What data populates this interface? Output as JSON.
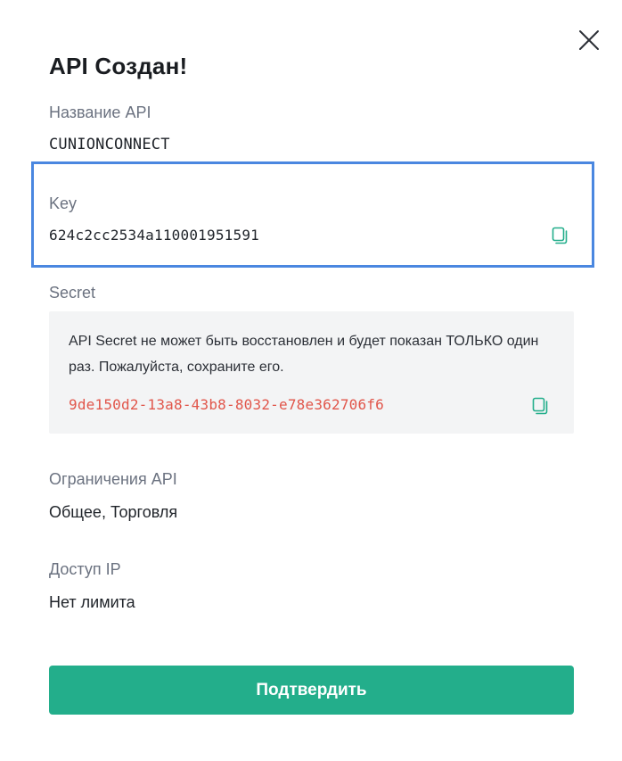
{
  "dialog": {
    "title": "API Создан!",
    "close_icon": "close-icon"
  },
  "api_name": {
    "label": "Название API",
    "value": "CUNIONCONNECT"
  },
  "key": {
    "label": "Key",
    "value": "624c2cc2534a110001951591",
    "copy_icon": "copy-icon"
  },
  "secret": {
    "label": "Secret",
    "warning": "API Secret не может быть восстановлен и будет показан ТОЛЬКО один раз. Пожалуйста, сохраните его.",
    "value": "9de150d2-13a8-43b8-8032-e78e362706f6",
    "copy_icon": "copy-icon"
  },
  "restrictions": {
    "label": "Ограничения API",
    "value": "Общее, Торговля"
  },
  "ip_access": {
    "label": "Доступ IP",
    "value": "Нет лимита"
  },
  "confirm_button": {
    "label": "Подтвердить"
  },
  "colors": {
    "accent_green": "#23ae8b",
    "secret_red": "#e1564b",
    "highlight_blue": "#4a87e0",
    "secret_box_bg": "#f3f4f5",
    "label_gray": "#6b7280"
  }
}
